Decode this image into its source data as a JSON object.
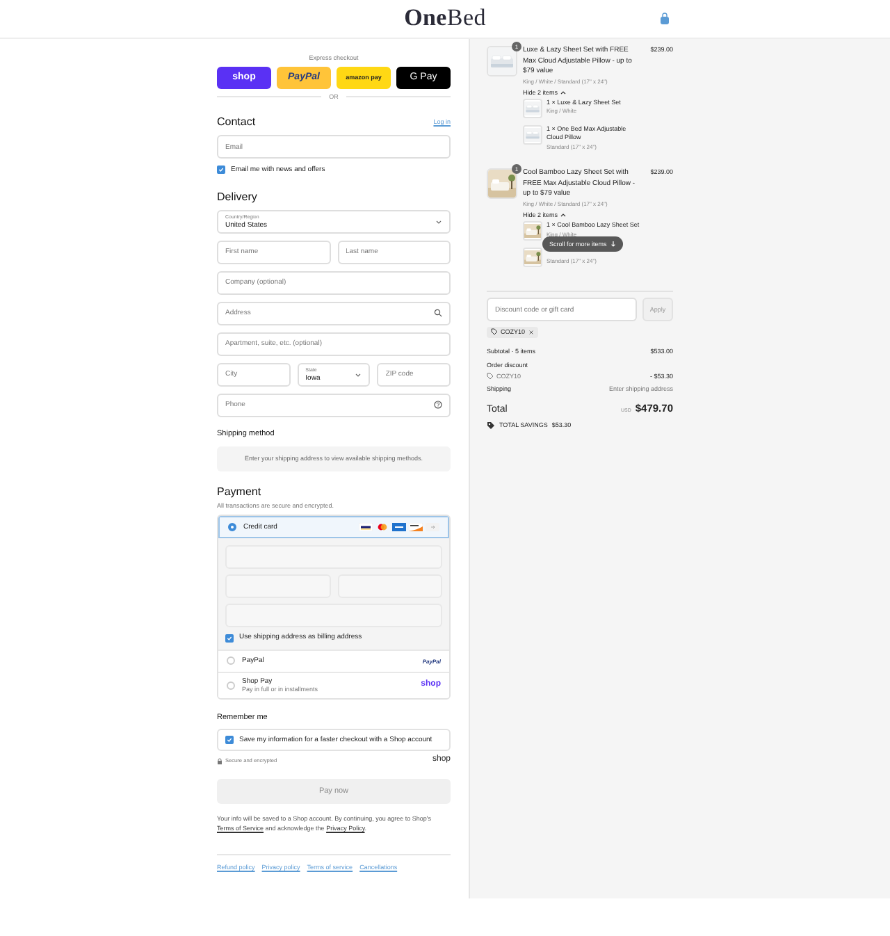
{
  "header": {
    "logo": "**One**Bed"
  },
  "express": {
    "title": "Express checkout",
    "buttons": [
      {
        "kind": "shop",
        "label": "shop"
      },
      {
        "kind": "paypal",
        "label": "PayPal"
      },
      {
        "kind": "amazon",
        "label": "amazon pay"
      },
      {
        "kind": "gpay",
        "label": "G Pay"
      }
    ],
    "divider": "OR"
  },
  "contact": {
    "title": "Contact",
    "login": "Log in",
    "email_placeholder": "Email",
    "newsletter": {
      "label": "Email me with news and offers",
      "checked": true
    }
  },
  "delivery": {
    "title": "Delivery",
    "rows": [
      [
        {
          "kind": "select",
          "label": "Country/Region",
          "value": "United States"
        }
      ],
      [
        {
          "kind": "input",
          "placeholder": "First name"
        },
        {
          "kind": "input",
          "placeholder": "Last name"
        }
      ],
      [
        {
          "kind": "input",
          "placeholder": "Company (optional)"
        }
      ],
      [
        {
          "kind": "search",
          "placeholder": "Address"
        }
      ],
      [
        {
          "kind": "input",
          "placeholder": "Apartment, suite, etc. (optional)"
        }
      ],
      [
        {
          "kind": "input",
          "placeholder": "City"
        },
        {
          "kind": "select",
          "label": "State",
          "value": "Iowa"
        },
        {
          "kind": "input",
          "placeholder": "ZIP code"
        }
      ],
      [
        {
          "kind": "help",
          "placeholder": "Phone"
        }
      ]
    ]
  },
  "shipping_method": {
    "title": "Shipping method",
    "message": "Enter your shipping address to view available shipping methods."
  },
  "payment": {
    "title": "Payment",
    "subtitle": "All transactions are secure and encrypted.",
    "methods": [
      {
        "kind": "card",
        "label": "Credit card",
        "selected": true,
        "billing": {
          "label": "Use shipping address as billing address",
          "checked": true
        }
      },
      {
        "kind": "paypal",
        "label": "PayPal",
        "selected": false,
        "logo": "PayPal"
      },
      {
        "kind": "shoppay",
        "label": "Shop Pay",
        "note": "Pay in full or in installments",
        "selected": false,
        "logo": "shop"
      }
    ]
  },
  "remember": {
    "title": "Remember me",
    "save": {
      "label": "Save my information for a faster checkout with a Shop account",
      "checked": true
    },
    "secure": "Secure and encrypted",
    "logo": "shop"
  },
  "pay_button": {
    "label": "Pay now",
    "disabled": true
  },
  "legal": [
    {
      "text": "Your info will be saved to a Shop account. By continuing, you agree to Shop's ",
      "link": false
    },
    {
      "text": "Terms of Service",
      "link": true
    },
    {
      "text": " and acknowledge the ",
      "link": false
    },
    {
      "text": "Privacy Policy",
      "link": true
    },
    {
      "text": ".",
      "link": false
    }
  ],
  "footer_links": [
    "Refund policy",
    "Privacy policy",
    "Terms of service",
    "Cancellations"
  ],
  "cart": {
    "items": [
      {
        "quantity": "1",
        "title": "Luxe & Lazy Sheet Set with FREE Max Cloud Adjustable Pillow - up to $79 value",
        "variant": "King / White / Standard (17\" x 24\")",
        "price": "$239.00",
        "toggle": "Hide 2 items",
        "expanded": true,
        "children": [
          {
            "title": "1 × Luxe & Lazy Sheet Set",
            "variant": "King / White"
          },
          {
            "title": "1 × One Bed Max Adjustable Cloud Pillow",
            "variant": "Standard (17\" x 24\")"
          }
        ]
      },
      {
        "quantity": "1",
        "title": "Cool Bamboo Lazy Sheet Set with FREE Max Adjustable Cloud Pillow - up to $79 value",
        "variant": "King / White / Standard (17\" x 24\")",
        "price": "$239.00",
        "toggle": "Hide 2 items",
        "expanded": true,
        "children": [
          {
            "title": "1 × Cool Bamboo Lazy Sheet Set",
            "variant": "King / White"
          },
          {
            "variant": "Standard (17\" x 24\")"
          }
        ]
      }
    ],
    "toast": "Scroll for more items",
    "discount": {
      "placeholder": "Discount code or gift card",
      "apply": "Apply",
      "apply_disabled": true,
      "codes": [
        "COZY10"
      ]
    },
    "summary": {
      "subtotal": {
        "label": "Subtotal · 5 items",
        "value": "$533.00"
      },
      "discount": {
        "label": "Order discount",
        "code": "COZY10",
        "value": "- $53.30"
      },
      "shipping": {
        "label": "Shipping",
        "value": "Enter shipping address"
      },
      "total": {
        "label": "Total",
        "currency": "USD",
        "value": "$479.70"
      },
      "savings": {
        "label": "TOTAL SAVINGS",
        "value": "$53.30"
      }
    }
  }
}
